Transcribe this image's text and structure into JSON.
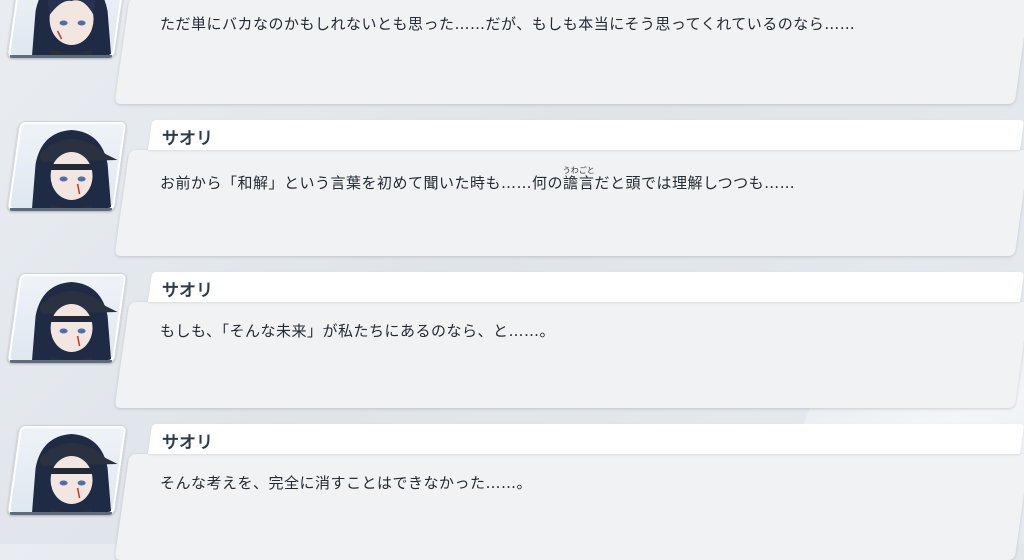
{
  "messages": [
    {
      "speaker": "",
      "text": "ただ単にバカなのかもしれないとも思った……だが、もしも本当にそう思ってくれているのなら……"
    },
    {
      "speaker": "サオリ",
      "text_before": "お前から「和解」という言葉を初めて聞いた時も……何の",
      "ruby_base": "譫言",
      "ruby_text": "うわごと",
      "text_after": "だと頭では理解しつつも……"
    },
    {
      "speaker": "サオリ",
      "text": "もしも、「そんな未来」が私たちにあるのなら、と……。"
    },
    {
      "speaker": "サオリ",
      "text": "そんな考えを、完全に消すことはできなかった……。"
    }
  ],
  "colors": {
    "bubble": "#f1f2f3",
    "namebar": "#ffffff",
    "name_text": "#2d3a4a",
    "body_text": "#222a33"
  },
  "icons": {
    "avatar": "saori-portrait-icon"
  }
}
